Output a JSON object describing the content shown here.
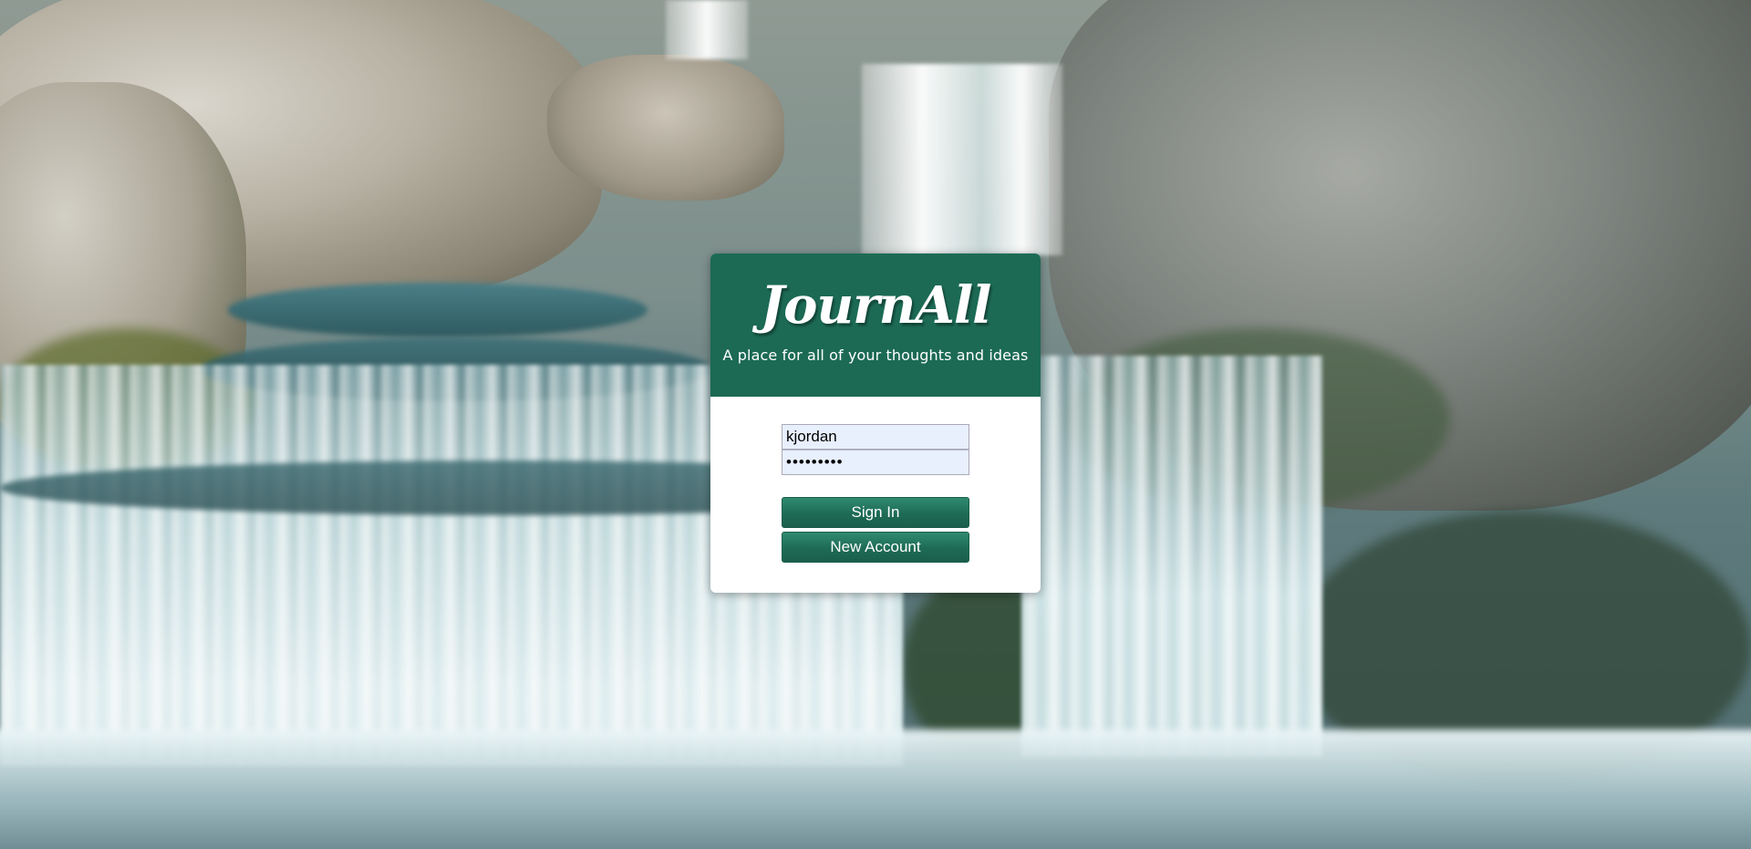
{
  "app": {
    "logo_text": "JournAll",
    "tagline": "A place for all of your thoughts and ideas"
  },
  "login": {
    "username_value": "kjordan",
    "password_value": "•••••••••",
    "sign_in_label": "Sign In",
    "new_account_label": "New Account"
  },
  "colors": {
    "header_green": "#1c6a54",
    "button_green": "#1e6b55",
    "input_autofill": "#e8effd"
  }
}
